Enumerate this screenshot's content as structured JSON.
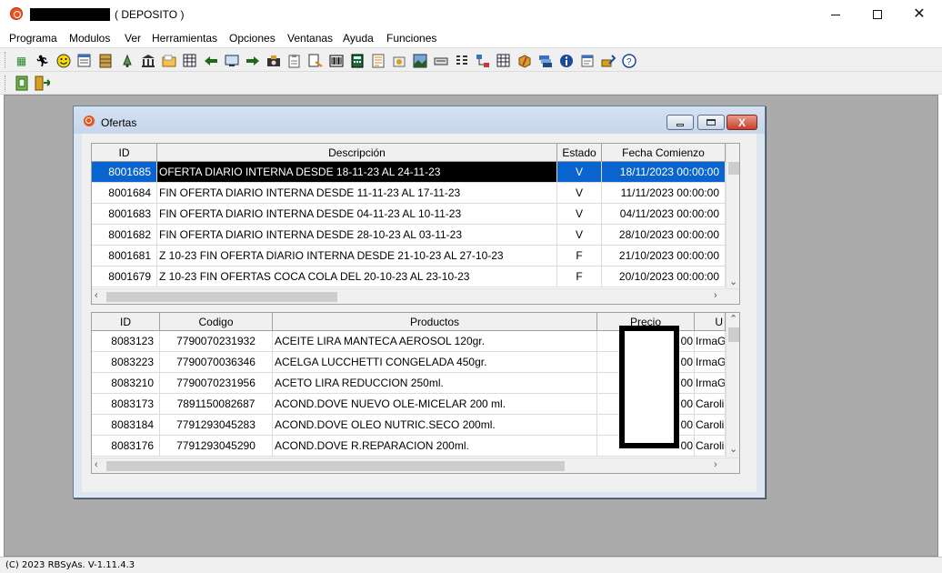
{
  "window": {
    "title_suffix": "( DEPOSITO )",
    "minimize": "—",
    "close": "✕"
  },
  "menu": [
    "Programa",
    "Modulos",
    "Ver",
    "Herramientas",
    "Opciones",
    "Ventanas",
    "Ayuda",
    "Funciones"
  ],
  "toolbar": {
    "row1_icons": [
      "grid-icon",
      "runner-icon",
      "smiley-icon",
      "form-icon",
      "cabinet-icon",
      "bell-icon",
      "bank-icon",
      "folder-icon",
      "table-icon",
      "arrow-left-icon",
      "monitor-icon",
      "arrow-right-icon",
      "camera-icon",
      "clipboard-icon",
      "document-icon",
      "barcode-icon",
      "calculator-icon",
      "list-icon",
      "pill-icon",
      "photo-icon",
      "keyboard-icon",
      "grid-list-icon",
      "network-icon",
      "table2-icon",
      "box-icon",
      "layers-icon",
      "info-icon",
      "notes-icon",
      "tools-icon",
      "help-icon"
    ],
    "row2_icons": [
      "book-icon",
      "exit-icon"
    ]
  },
  "ofertas": {
    "title": "Ofertas",
    "close": "X",
    "columns": [
      "ID",
      "Descripción",
      "Estado",
      "Fecha Comienzo"
    ],
    "rows": [
      {
        "id": "8001685",
        "desc": "OFERTA DIARIO INTERNA DESDE 18-11-23 AL 24-11-23",
        "estado": "V",
        "fecha": "18/11/2023 00:00:00"
      },
      {
        "id": "8001684",
        "desc": "FIN OFERTA DIARIO INTERNA DESDE 11-11-23 AL 17-11-23",
        "estado": "V",
        "fecha": "11/11/2023 00:00:00"
      },
      {
        "id": "8001683",
        "desc": "FIN OFERTA DIARIO INTERNA DESDE 04-11-23 AL 10-11-23",
        "estado": "V",
        "fecha": "04/11/2023 00:00:00"
      },
      {
        "id": "8001682",
        "desc": "FIN OFERTA DIARIO INTERNA DESDE 28-10-23 AL 03-11-23",
        "estado": "V",
        "fecha": "28/10/2023 00:00:00"
      },
      {
        "id": "8001681",
        "desc": "Z 10-23 FIN OFERTA DIARIO INTERNA DESDE 21-10-23 AL 27-10-23",
        "estado": "F",
        "fecha": "21/10/2023 00:00:00"
      },
      {
        "id": "8001679",
        "desc": "Z 10-23 FIN OFERTAS COCA COLA DEL 20-10-23 AL 23-10-23",
        "estado": "F",
        "fecha": "20/10/2023 00:00:00"
      }
    ]
  },
  "productos": {
    "columns": [
      "ID",
      "Codigo",
      "Productos",
      "Precio",
      "U"
    ],
    "rows": [
      {
        "id": "8083123",
        "codigo": "7790070231932",
        "producto": "ACEITE LIRA MANTECA AEROSOL 120gr.",
        "precio": "00",
        "u": "IrmaG"
      },
      {
        "id": "8083223",
        "codigo": "7790070036346",
        "producto": "ACELGA LUCCHETTI CONGELADA 450gr.",
        "precio": "00",
        "u": "IrmaG"
      },
      {
        "id": "8083210",
        "codigo": "7790070231956",
        "producto": "ACETO LIRA REDUCCION 250ml.",
        "precio": "00",
        "u": "IrmaG"
      },
      {
        "id": "8083173",
        "codigo": "7891150082687",
        "producto": "ACOND.DOVE NUEVO OLE-MICELAR 200 ml.",
        "precio": "00",
        "u": "Caroli"
      },
      {
        "id": "8083184",
        "codigo": "7791293045283",
        "producto": "ACOND.DOVE OLEO NUTRIC.SECO 200ml.",
        "precio": "00",
        "u": "Caroli"
      },
      {
        "id": "8083176",
        "codigo": "7791293045290",
        "producto": "ACOND.DOVE R.REPARACION 200ml.",
        "precio": "00",
        "u": "Caroli"
      }
    ]
  },
  "status": "(C) 2023 RBSyAs. V-1.11.4.3"
}
